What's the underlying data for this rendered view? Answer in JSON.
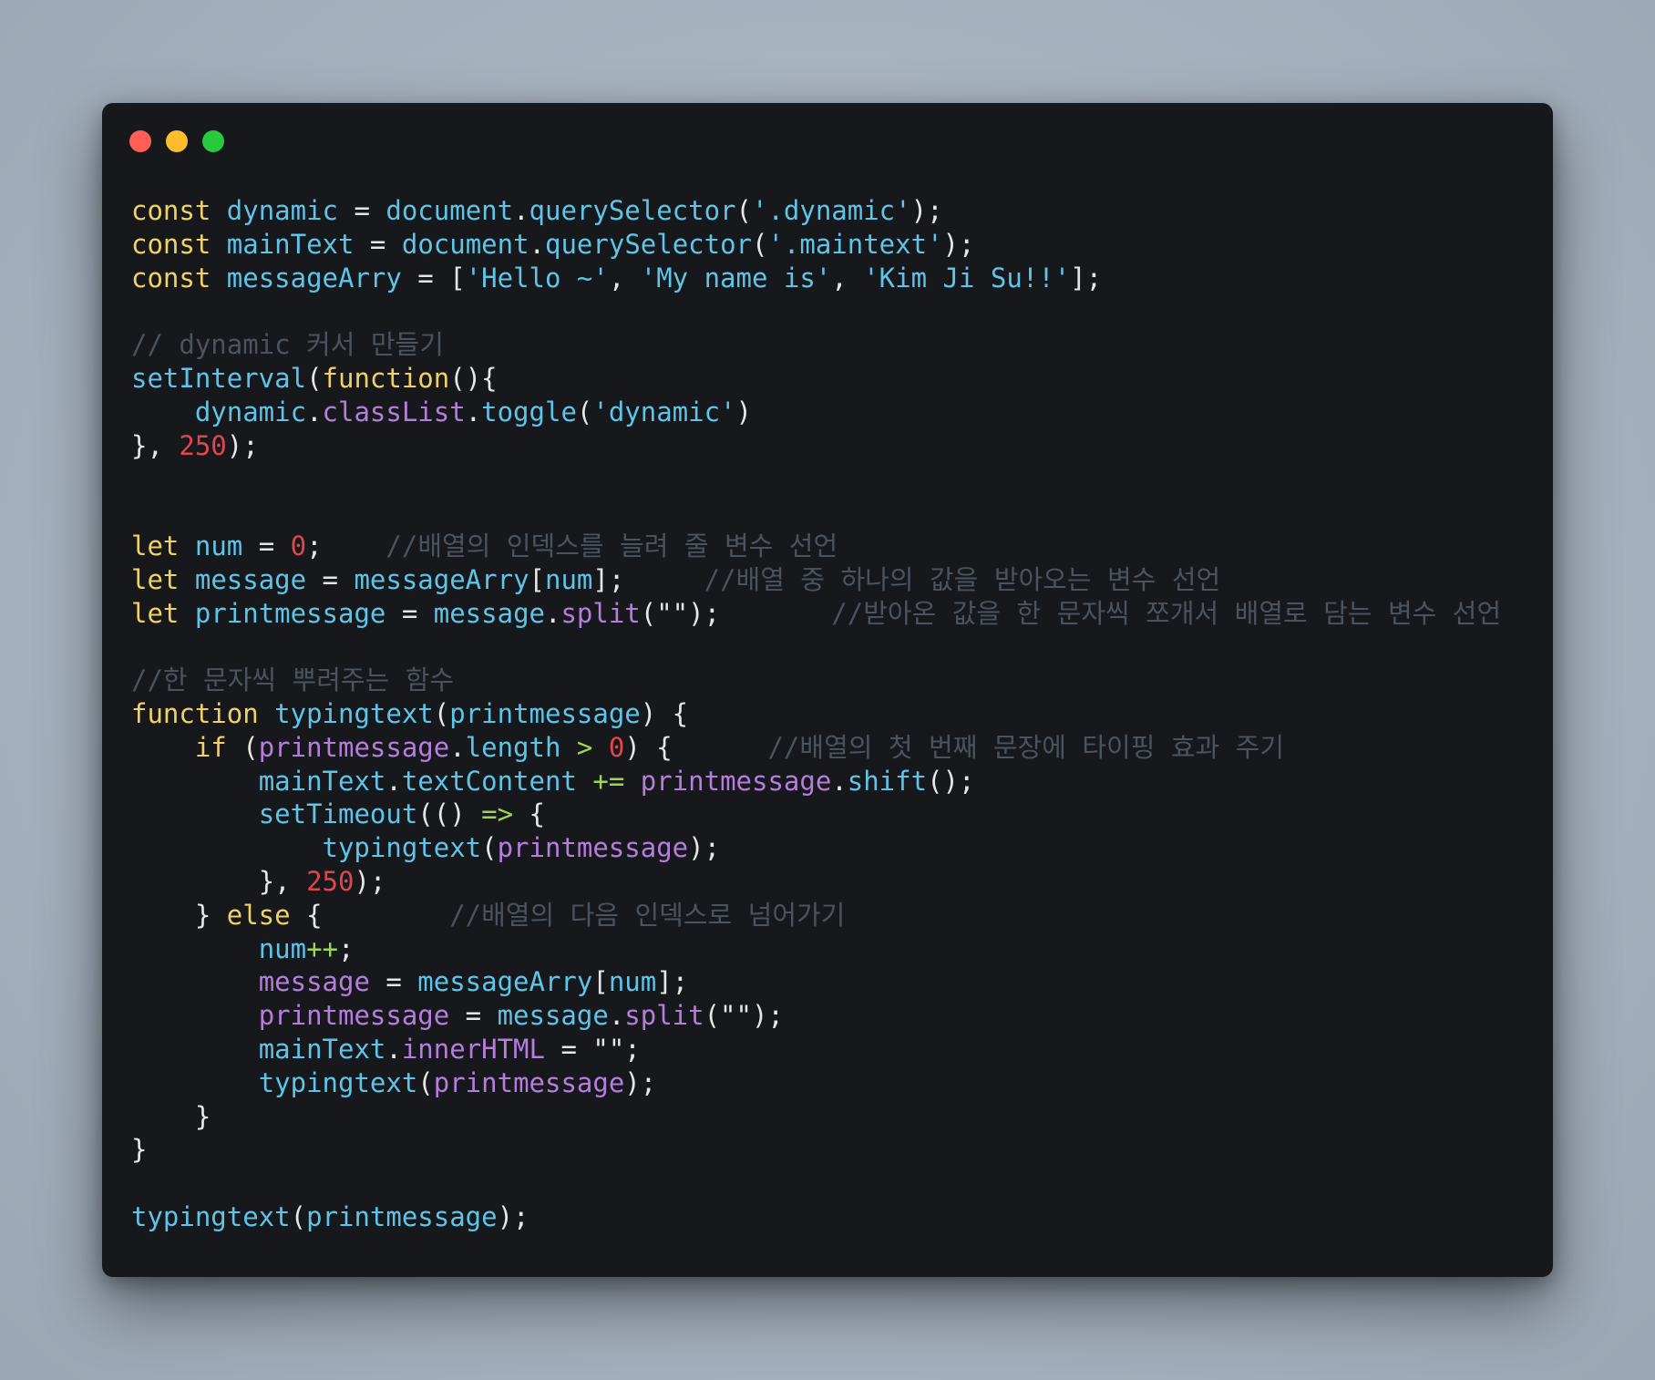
{
  "window": {
    "controls": [
      "close",
      "minimize",
      "maximize"
    ]
  },
  "code": {
    "lines": [
      [
        [
          "kw",
          "const"
        ],
        [
          "pl",
          " "
        ],
        [
          "var",
          "dynamic"
        ],
        [
          "pl",
          " = "
        ],
        [
          "var",
          "document"
        ],
        [
          "pu",
          "."
        ],
        [
          "fn",
          "querySelector"
        ],
        [
          "pu",
          "("
        ],
        [
          "str",
          "'.dynamic'"
        ],
        [
          "pu",
          ");"
        ]
      ],
      [
        [
          "kw",
          "const"
        ],
        [
          "pl",
          " "
        ],
        [
          "var",
          "mainText"
        ],
        [
          "pl",
          " = "
        ],
        [
          "var",
          "document"
        ],
        [
          "pu",
          "."
        ],
        [
          "fn",
          "querySelector"
        ],
        [
          "pu",
          "("
        ],
        [
          "str",
          "'.maintext'"
        ],
        [
          "pu",
          ");"
        ]
      ],
      [
        [
          "kw",
          "const"
        ],
        [
          "pl",
          " "
        ],
        [
          "var",
          "messageArry"
        ],
        [
          "pl",
          " = ["
        ],
        [
          "str",
          "'Hello ~'"
        ],
        [
          "pl",
          ", "
        ],
        [
          "str",
          "'My name is'"
        ],
        [
          "pl",
          ", "
        ],
        [
          "str",
          "'Kim Ji Su!!'"
        ],
        [
          "pu",
          "];"
        ]
      ],
      [],
      [
        [
          "cm",
          "// dynamic 커서 만들기"
        ]
      ],
      [
        [
          "fn",
          "setInterval"
        ],
        [
          "pu",
          "("
        ],
        [
          "kw",
          "function"
        ],
        [
          "pu",
          "(){"
        ]
      ],
      [
        [
          "pl",
          "    "
        ],
        [
          "var",
          "dynamic"
        ],
        [
          "pu",
          "."
        ],
        [
          "prop",
          "classList"
        ],
        [
          "pu",
          "."
        ],
        [
          "fn",
          "toggle"
        ],
        [
          "pu",
          "("
        ],
        [
          "str",
          "'dynamic'"
        ],
        [
          "pu",
          ")"
        ]
      ],
      [
        [
          "pu",
          "}, "
        ],
        [
          "num",
          "250"
        ],
        [
          "pu",
          ");"
        ]
      ],
      [],
      [],
      [
        [
          "kw",
          "let"
        ],
        [
          "pl",
          " "
        ],
        [
          "var",
          "num"
        ],
        [
          "pl",
          " = "
        ],
        [
          "num",
          "0"
        ],
        [
          "pu",
          ";"
        ],
        [
          "pl",
          "    "
        ],
        [
          "cm",
          "//배열의 인덱스를 늘려 줄 변수 선언"
        ]
      ],
      [
        [
          "kw",
          "let"
        ],
        [
          "pl",
          " "
        ],
        [
          "var",
          "message"
        ],
        [
          "pl",
          " = "
        ],
        [
          "var",
          "messageArry"
        ],
        [
          "pu",
          "["
        ],
        [
          "var",
          "num"
        ],
        [
          "pu",
          "];"
        ],
        [
          "pl",
          "     "
        ],
        [
          "cm",
          "//배열 중 하나의 값을 받아오는 변수 선언"
        ]
      ],
      [
        [
          "kw",
          "let"
        ],
        [
          "pl",
          " "
        ],
        [
          "var",
          "printmessage"
        ],
        [
          "pl",
          " = "
        ],
        [
          "var",
          "message"
        ],
        [
          "pu",
          "."
        ],
        [
          "prop",
          "split"
        ],
        [
          "pu",
          "(\"\");"
        ],
        [
          "pl",
          "       "
        ],
        [
          "cm",
          "//받아온 값을 한 문자씩 쪼개서 배열로 담는 변수 선언"
        ]
      ],
      [],
      [
        [
          "cm",
          "//한 문자씩 뿌려주는 함수"
        ]
      ],
      [
        [
          "kw",
          "function"
        ],
        [
          "pl",
          " "
        ],
        [
          "fn",
          "typingtext"
        ],
        [
          "pu",
          "("
        ],
        [
          "var",
          "printmessage"
        ],
        [
          "pu",
          ") {"
        ]
      ],
      [
        [
          "pl",
          "    "
        ],
        [
          "kw",
          "if"
        ],
        [
          "pl",
          " ("
        ],
        [
          "prop",
          "printmessage"
        ],
        [
          "pu",
          "."
        ],
        [
          "var",
          "length"
        ],
        [
          "pl",
          " "
        ],
        [
          "op",
          ">"
        ],
        [
          "pl",
          " "
        ],
        [
          "num",
          "0"
        ],
        [
          "pu",
          ") {"
        ],
        [
          "pl",
          "      "
        ],
        [
          "cm",
          "//배열의 첫 번째 문장에 타이핑 효과 주기"
        ]
      ],
      [
        [
          "pl",
          "        "
        ],
        [
          "var",
          "mainText"
        ],
        [
          "pu",
          "."
        ],
        [
          "var",
          "textContent"
        ],
        [
          "pl",
          " "
        ],
        [
          "op",
          "+="
        ],
        [
          "pl",
          " "
        ],
        [
          "prop",
          "printmessage"
        ],
        [
          "pu",
          "."
        ],
        [
          "fn",
          "shift"
        ],
        [
          "pu",
          "();"
        ]
      ],
      [
        [
          "pl",
          "        "
        ],
        [
          "fn",
          "setTimeout"
        ],
        [
          "pu",
          "(() "
        ],
        [
          "op",
          "=>"
        ],
        [
          "pu",
          " {"
        ]
      ],
      [
        [
          "pl",
          "            "
        ],
        [
          "fn",
          "typingtext"
        ],
        [
          "pu",
          "("
        ],
        [
          "prop",
          "printmessage"
        ],
        [
          "pu",
          ");"
        ]
      ],
      [
        [
          "pl",
          "        "
        ],
        [
          "pu",
          "}, "
        ],
        [
          "num",
          "250"
        ],
        [
          "pu",
          ");"
        ]
      ],
      [
        [
          "pl",
          "    "
        ],
        [
          "pu",
          "} "
        ],
        [
          "kw",
          "else"
        ],
        [
          "pu",
          " {"
        ],
        [
          "pl",
          "        "
        ],
        [
          "cm",
          "//배열의 다음 인덱스로 넘어가기"
        ]
      ],
      [
        [
          "pl",
          "        "
        ],
        [
          "var",
          "num"
        ],
        [
          "op",
          "++"
        ],
        [
          "pu",
          ";"
        ]
      ],
      [
        [
          "pl",
          "        "
        ],
        [
          "prop",
          "message"
        ],
        [
          "pl",
          " = "
        ],
        [
          "var",
          "messageArry"
        ],
        [
          "pu",
          "["
        ],
        [
          "var",
          "num"
        ],
        [
          "pu",
          "];"
        ]
      ],
      [
        [
          "pl",
          "        "
        ],
        [
          "prop",
          "printmessage"
        ],
        [
          "pl",
          " = "
        ],
        [
          "var",
          "message"
        ],
        [
          "pu",
          "."
        ],
        [
          "prop",
          "split"
        ],
        [
          "pu",
          "(\"\");"
        ]
      ],
      [
        [
          "pl",
          "        "
        ],
        [
          "var",
          "mainText"
        ],
        [
          "pu",
          "."
        ],
        [
          "prop",
          "innerHTML"
        ],
        [
          "pl",
          " = "
        ],
        [
          "pu",
          "\"\";"
        ]
      ],
      [
        [
          "pl",
          "        "
        ],
        [
          "fn",
          "typingtext"
        ],
        [
          "pu",
          "("
        ],
        [
          "prop",
          "printmessage"
        ],
        [
          "pu",
          ");"
        ]
      ],
      [
        [
          "pl",
          "    "
        ],
        [
          "pu",
          "}"
        ]
      ],
      [
        [
          "pu",
          "}"
        ]
      ],
      [],
      [
        [
          "fn",
          "typingtext"
        ],
        [
          "pu",
          "("
        ],
        [
          "var",
          "printmessage"
        ],
        [
          "pu",
          ");"
        ]
      ]
    ]
  }
}
